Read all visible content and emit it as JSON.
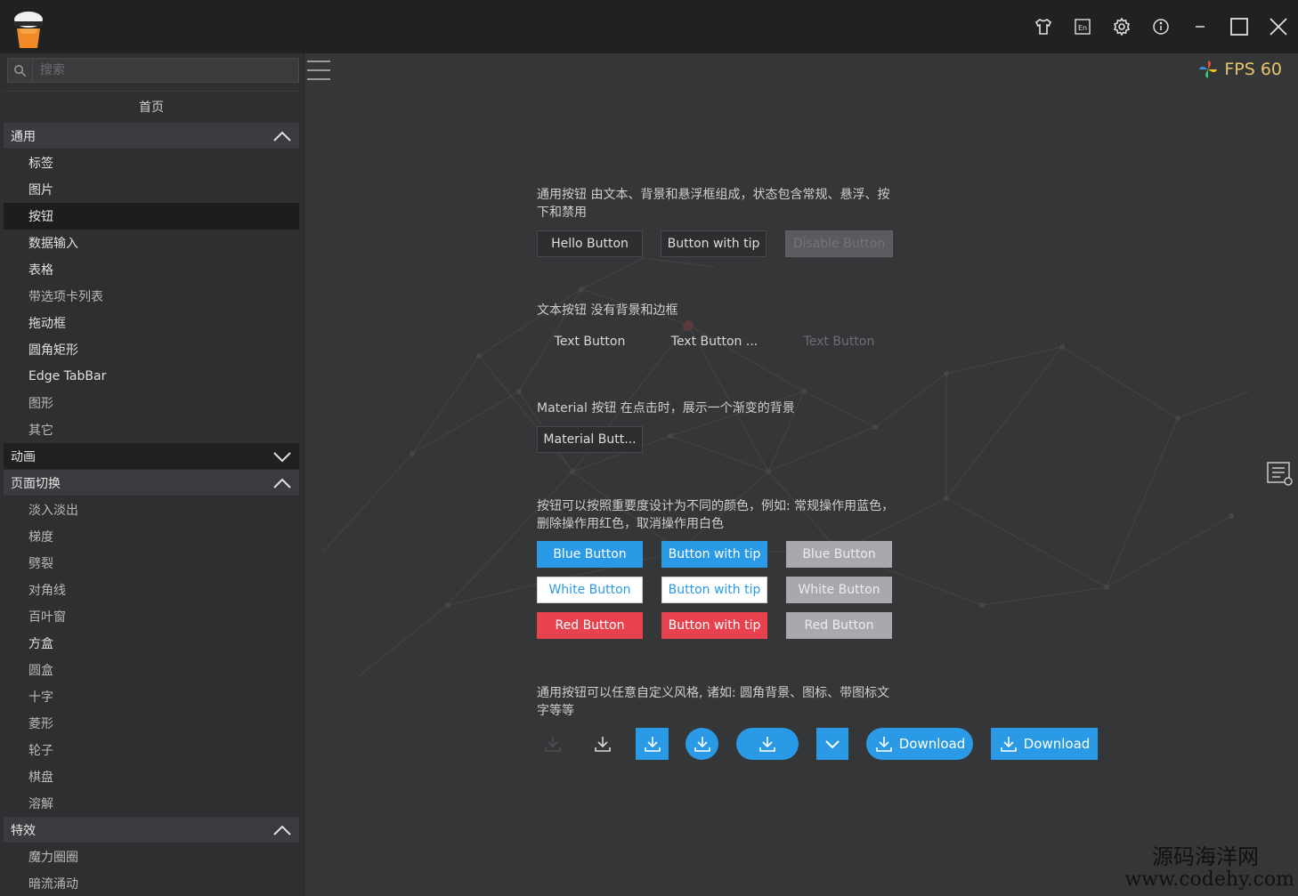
{
  "titlebar": {
    "icons": [
      "shirt-icon",
      "language-icon",
      "gear-icon",
      "info-icon",
      "minimize-icon",
      "maximize-icon",
      "close-icon"
    ],
    "language_label": "En"
  },
  "sidebar": {
    "search_placeholder": "搜索",
    "home_label": "首页",
    "groups": [
      {
        "label": "通用",
        "expanded": true,
        "items": [
          "标签",
          "图片",
          "按钮",
          "数据输入",
          "表格",
          "带选项卡列表",
          "拖动框",
          "圆角矩形",
          "Edge TabBar",
          "图形",
          "其它"
        ],
        "active_index": 2
      },
      {
        "label": "动画",
        "expanded": false,
        "items": []
      },
      {
        "label": "页面切换",
        "expanded": true,
        "items": [
          "淡入淡出",
          "梯度",
          "劈裂",
          "对角线",
          "百叶窗",
          "方盒",
          "圆盒",
          "十字",
          "菱形",
          "轮子",
          "棋盘",
          "溶解"
        ]
      },
      {
        "label": "特效",
        "expanded": true,
        "items": [
          "魔力圈圈",
          "暗流涌动"
        ]
      }
    ]
  },
  "main": {
    "fps_label": "FPS 60",
    "sections": {
      "general": {
        "desc": "通用按钮 由文本、背景和悬浮框组成，状态包含常规、悬浮、按下和禁用",
        "buttons": [
          "Hello Button",
          "Button with tip",
          "Disable Button"
        ]
      },
      "text": {
        "desc": "文本按钮 没有背景和边框",
        "buttons": [
          "Text Button",
          "Text Button ...",
          "Text Button"
        ]
      },
      "material": {
        "desc": "Material 按钮 在点击时，展示一个渐变的背景",
        "buttons": [
          "Material Butt..."
        ]
      },
      "colors": {
        "desc": "按钮可以按照重要度设计为不同的颜色，例如: 常规操作用蓝色，删除操作用红色，取消操作用白色",
        "rows": [
          [
            "Blue Button",
            "Button with tip",
            "Blue Button"
          ],
          [
            "White Button",
            "Button with tip",
            "White Button"
          ],
          [
            "Red Button",
            "Button with tip",
            "Red Button"
          ]
        ]
      },
      "custom": {
        "desc": "通用按钮可以任意自定义风格, 诸如: 圆角背景、图标、带图标文字等等",
        "download_labels": [
          "Download",
          "Download"
        ]
      }
    }
  },
  "colors": {
    "blue": "#2b9ae6",
    "red": "#e8424f",
    "gray": "#a8a9ad",
    "fps": "#e8c46a"
  },
  "watermark": {
    "line1": "源码海洋网",
    "line2": "www.codehy.com"
  }
}
